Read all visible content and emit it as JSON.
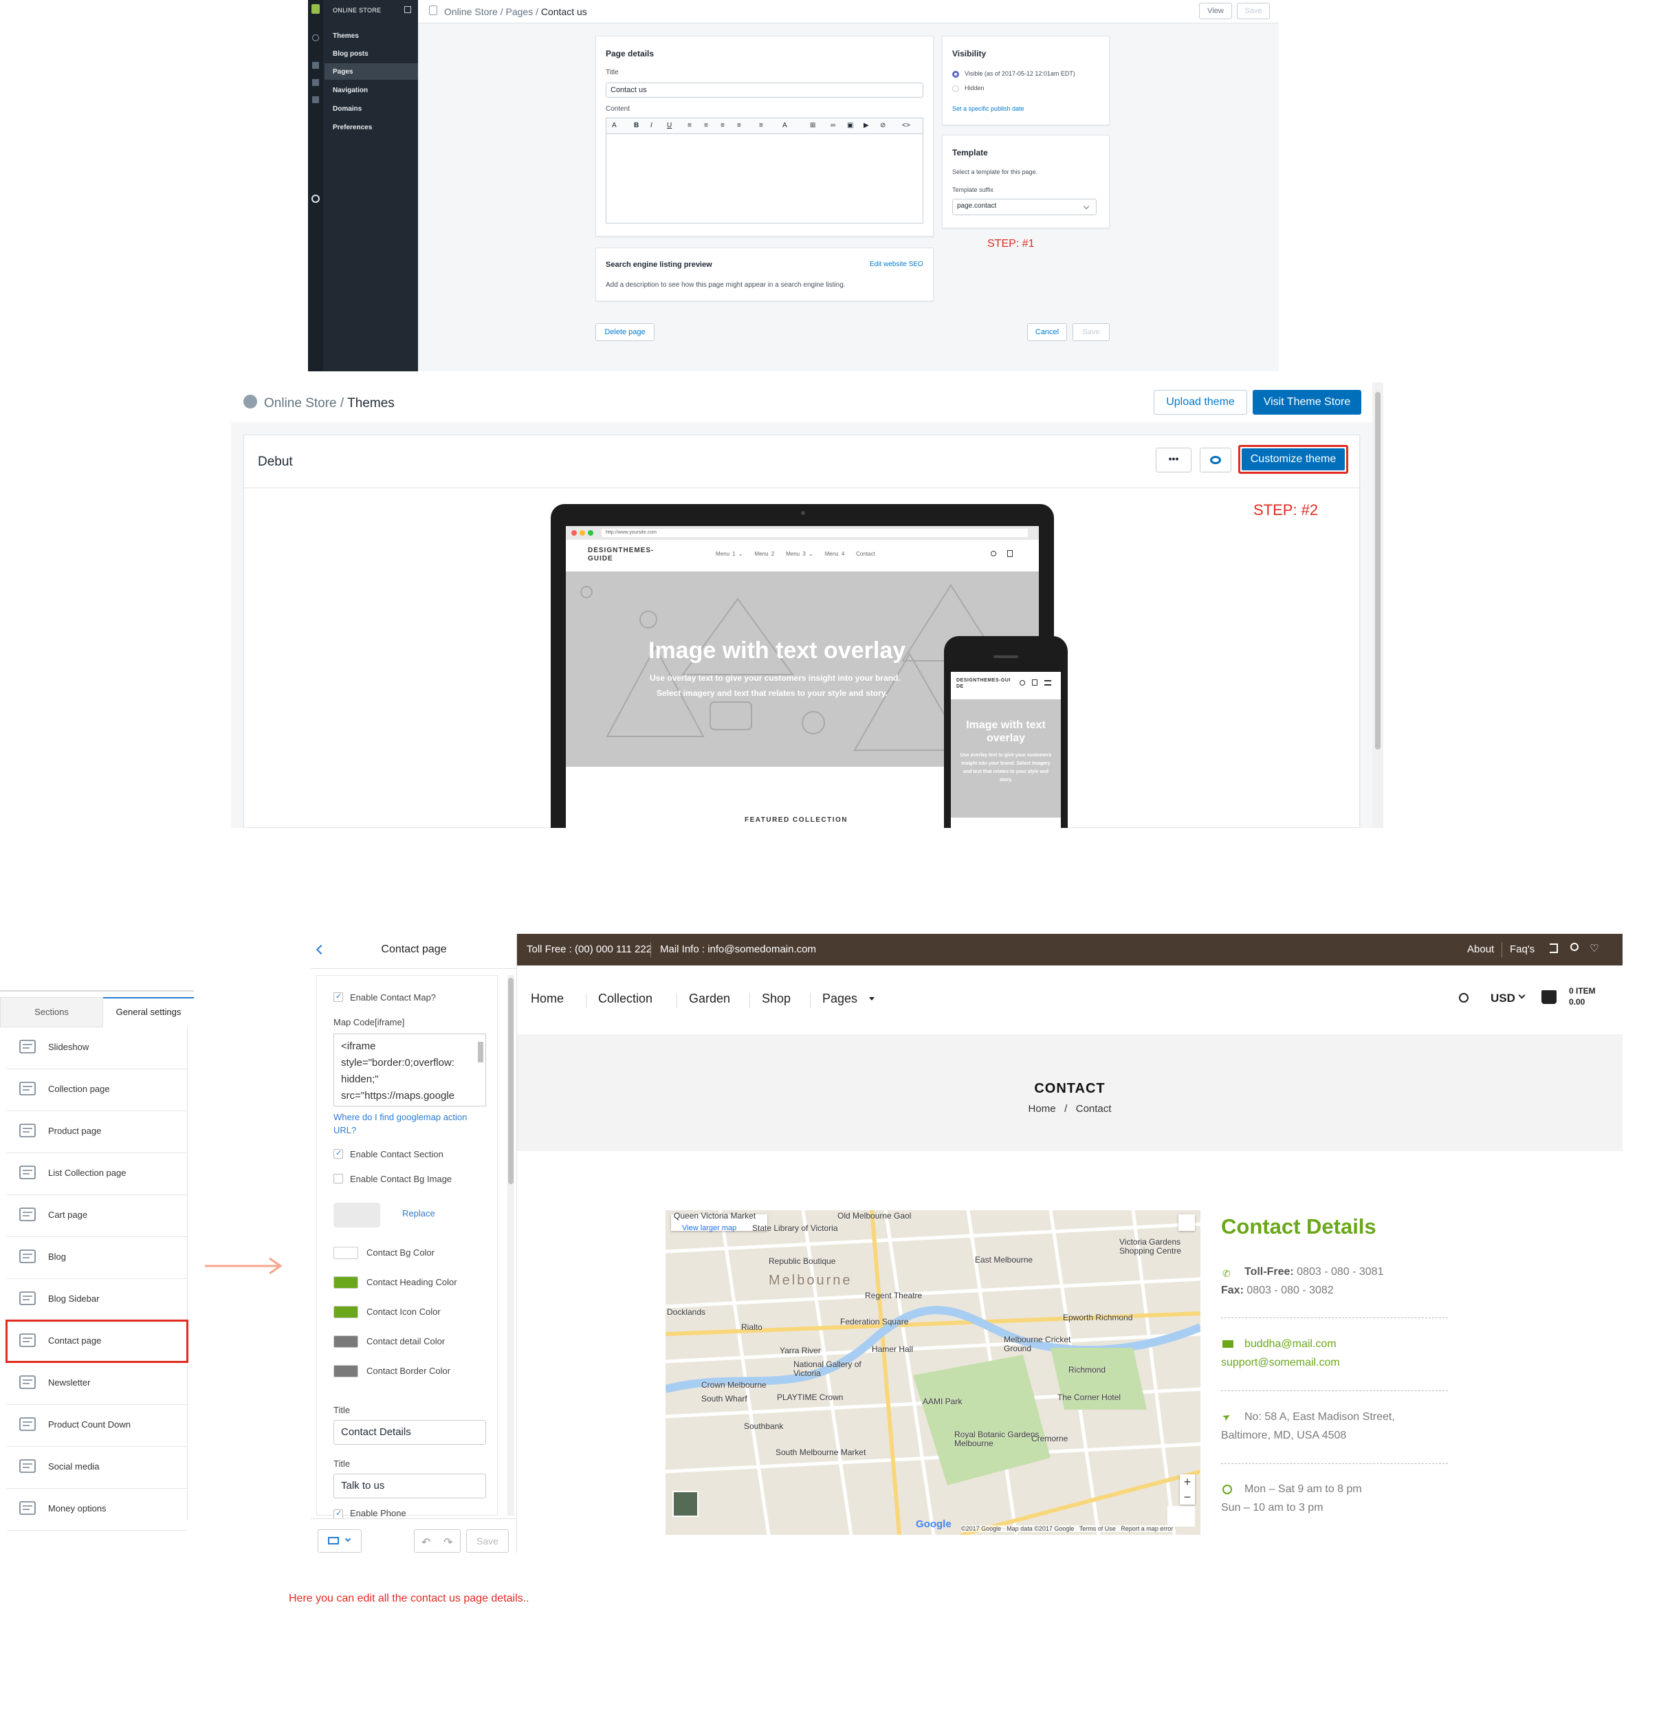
{
  "panel1": {
    "sidebar": {
      "header": "ONLINE STORE",
      "items": [
        "Themes",
        "Blog posts",
        "Pages",
        "Navigation",
        "Domains",
        "Preferences"
      ]
    },
    "breadcrumb": {
      "a": "Online Store",
      "sep1": "/",
      "b": "Pages",
      "sep2": "/",
      "c": "Contact us"
    },
    "top_buttons": {
      "view": "View",
      "save": "Save"
    },
    "page_details": {
      "heading": "Page details",
      "title_label": "Title",
      "title_value": "Contact us",
      "content_label": "Content",
      "toolbar": [
        "A",
        "B",
        "I",
        "U",
        "≡",
        "≡",
        "≡",
        "≡",
        "≡",
        "A",
        "⊞",
        "∞",
        "▣",
        "▶",
        "⊘",
        "<>"
      ]
    },
    "seo": {
      "heading": "Search engine listing preview",
      "edit_link": "Edit website SEO",
      "desc": "Add a description to see how this page might appear in a search engine listing."
    },
    "visibility": {
      "heading": "Visibility",
      "visible": "Visible (as of 2017-05-12 12:01am EDT)",
      "hidden": "Hidden",
      "publish_link": "Set a specific publish date"
    },
    "template": {
      "heading": "Template",
      "desc": "Select a template for this page.",
      "suffix_label": "Template suffix",
      "suffix_value": "page.contact"
    },
    "step": "STEP: #1",
    "footer": {
      "delete": "Delete page",
      "cancel": "Cancel",
      "save": "Save"
    }
  },
  "panel2": {
    "breadcrumb": {
      "a": "Online Store",
      "sep": "/",
      "b": "Themes"
    },
    "upload_button": "Upload theme",
    "visit_button": "Visit Theme Store",
    "theme_name": "Debut",
    "more_button": "•••",
    "customize_button": "Customize theme",
    "step": "STEP: #2",
    "preview": {
      "url": "http://www.yoursite.com",
      "brand": "DESIGNTHEMES-GUIDE",
      "menu": [
        "Menu 1 ⌄",
        "Menu 2",
        "Menu 3 ⌄",
        "Menu 4",
        "Contact"
      ],
      "hero_title": "Image with text overlay",
      "hero_line1": "Use overlay text to give your customers insight into your brand.",
      "hero_line2": "Select imagery and text that relates to your style and story.",
      "featured": "FEATURED COLLECTION",
      "phone_brand": "DESIGNTHEMES-GUIDE",
      "phone_title": "Image with text overlay",
      "phone_text": "Use overlay text to give your customers insight into your brand. Select imagery and text that relates to your style and story."
    }
  },
  "panel3": {
    "tabs": {
      "sections": "Sections",
      "general": "General settings"
    },
    "items": [
      "Slideshow",
      "Collection page",
      "Product page",
      "List Collection page",
      "Cart page",
      "Blog",
      "Blog Sidebar",
      "Contact page",
      "Newsletter",
      "Product Count Down",
      "Social media",
      "Money options"
    ],
    "editor": {
      "title": "Contact page",
      "enable_map": "Enable Contact Map?",
      "map_code_label": "Map Code[iframe]",
      "map_code": "<iframe\nstyle=\"border:0;overflow:\nhidden;\"\nsrc=\"https://maps.google",
      "help_link": "Where do I find googlemap action URL?",
      "enable_section": "Enable Contact Section",
      "enable_bg": "Enable Contact Bg Image",
      "replace": "Replace",
      "colors": [
        {
          "label": "Contact Bg Color",
          "color": "#ffffff"
        },
        {
          "label": "Contact Heading Color",
          "color": "#6aa71a"
        },
        {
          "label": "Contact Icon Color",
          "color": "#6aa71a"
        },
        {
          "label": "Contact detail Color",
          "color": "#7a7a7a"
        },
        {
          "label": "Contact Border Color",
          "color": "#7a7a7a"
        }
      ],
      "title1_label": "Title",
      "title1_value": "Contact Details",
      "title2_label": "Title",
      "title2_value": "Talk to us",
      "enable_phone": "Enable Phone",
      "save": "Save"
    },
    "store": {
      "topbar_left1": "Toll Free : (00) 000 111 222",
      "topbar_left2": "Mail Info : info@somedomain.com",
      "topbar_about": "About",
      "topbar_faq": "Faq's",
      "nav": [
        "Home",
        "Collection",
        "Garden",
        "Shop",
        "Pages"
      ],
      "currency": "USD",
      "cart_items": "0 ITEM",
      "cart_total": "0.00",
      "page_title": "CONTACT",
      "crumb_home": "Home",
      "crumb_sep": "/",
      "crumb_current": "Contact",
      "map": {
        "view_larger": "View larger map",
        "labels": [
          "Queen Victoria Market",
          "Old Melbourne Gaol",
          "State Library of Victoria",
          "Republic Boutique",
          "Melbourne",
          "East Melbourne",
          "Regent Theatre",
          "Federation Square",
          "Rialto",
          "Hamer Hall",
          "National Gallery of Victoria",
          "Crown Melbourne",
          "South Wharf",
          "PLAYTIME Crown",
          "AAMI Park",
          "Southbank",
          "Royal Botanic Gardens Melbourne",
          "South Melbourne Market",
          "Cremorne",
          "The Corner Hotel",
          "Richmond",
          "Epworth Richmond",
          "Melbourne Cricket Ground",
          "Victoria Gardens Shopping Centre",
          "Docklands",
          "Yarra River"
        ],
        "footer": "©2017 Google · Map data ©2017 Google   Terms of Use   Report a map error",
        "google": "Google"
      },
      "details_title": "Contact Details",
      "tollfree_label": "Toll-Free:",
      "tollfree": "0803 - 080 - 3081",
      "fax_label": "Fax:",
      "fax": "0803 - 080 - 3082",
      "email1": "buddha@mail.com",
      "email2": "support@somemail.com",
      "address1": "No: 58 A, East Madison Street,",
      "address2": "Baltimore, MD, USA 4508",
      "hours1": "Mon – Sat 9 am to 8 pm",
      "hours2": "Sun – 10 am to 3 pm"
    },
    "caption": "Here you can edit all the contact us page  details.."
  }
}
